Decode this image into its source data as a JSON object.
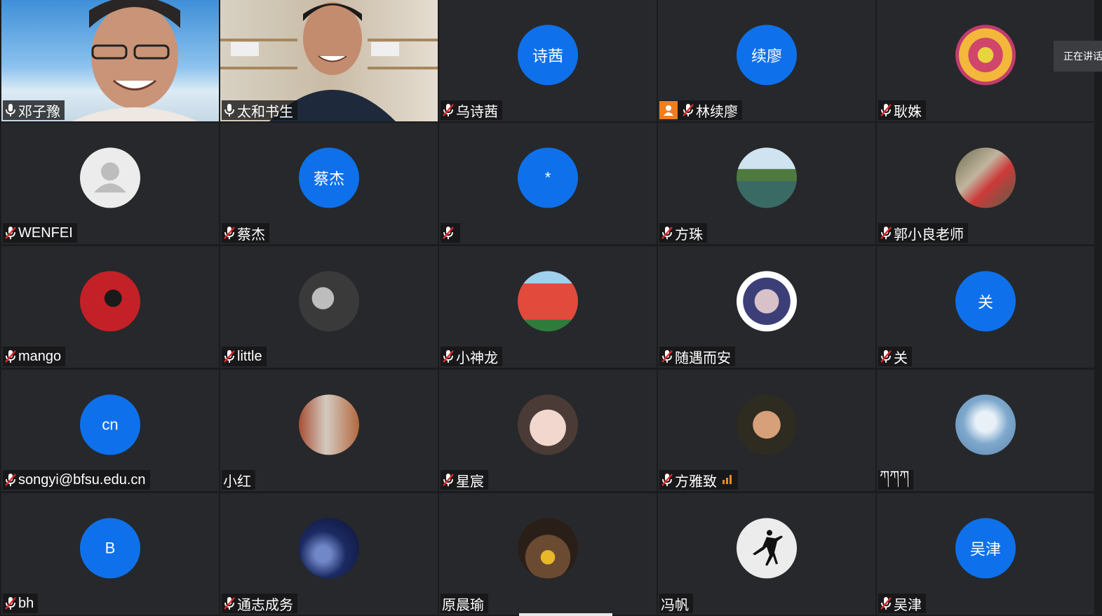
{
  "speaking_label": "正在讲话",
  "participants": [
    {
      "name": "邓子豫",
      "type": "video",
      "mic": "on",
      "avatar_text": "",
      "avatar_icon": "video-man-1"
    },
    {
      "name": "太和书生",
      "type": "video",
      "mic": "on",
      "avatar_text": "",
      "avatar_icon": "video-man-2"
    },
    {
      "name": "乌诗茜",
      "type": "initials",
      "mic": "muted",
      "avatar_text": "诗茜",
      "avatar_icon": ""
    },
    {
      "name": "林续廖",
      "type": "initials",
      "mic": "muted",
      "avatar_text": "续廖",
      "avatar_icon": "",
      "badge": "person-icon"
    },
    {
      "name": "耿姝",
      "type": "photo",
      "mic": "muted",
      "avatar_text": "",
      "avatar_icon": "mandala-photo"
    },
    {
      "name": "WENFEI",
      "type": "default",
      "mic": "muted",
      "avatar_text": "",
      "avatar_icon": "default-user-icon"
    },
    {
      "name": "蔡杰",
      "type": "initials",
      "mic": "muted",
      "avatar_text": "蔡杰",
      "avatar_icon": ""
    },
    {
      "name": "",
      "type": "initials",
      "mic": "muted",
      "avatar_text": "*",
      "avatar_icon": ""
    },
    {
      "name": "方珠",
      "type": "photo",
      "mic": "muted",
      "avatar_text": "",
      "avatar_icon": "lake-photo"
    },
    {
      "name": "郭小良老师",
      "type": "photo",
      "mic": "muted",
      "avatar_text": "",
      "avatar_icon": "child-photo"
    },
    {
      "name": "mango",
      "type": "photo",
      "mic": "muted",
      "avatar_text": "",
      "avatar_icon": "red-portrait-photo"
    },
    {
      "name": "little",
      "type": "photo",
      "mic": "muted",
      "avatar_text": "",
      "avatar_icon": "girl-bw-photo"
    },
    {
      "name": "小神龙",
      "type": "photo",
      "mic": "muted",
      "avatar_text": "",
      "avatar_icon": "watermelon-photo"
    },
    {
      "name": "随遇而安",
      "type": "photo",
      "mic": "muted",
      "avatar_text": "",
      "avatar_icon": "woman-portrait-photo"
    },
    {
      "name": "关",
      "type": "initials",
      "mic": "muted",
      "avatar_text": "关",
      "avatar_icon": ""
    },
    {
      "name": "songyi@bfsu.edu.cn",
      "type": "initials",
      "mic": "muted",
      "avatar_text": "cn",
      "avatar_icon": ""
    },
    {
      "name": "小红",
      "type": "photo",
      "mic": "none",
      "avatar_text": "",
      "avatar_icon": "walking-man-photo"
    },
    {
      "name": "星宸",
      "type": "photo",
      "mic": "muted",
      "avatar_text": "",
      "avatar_icon": "glasses-girl-photo"
    },
    {
      "name": "方雅致",
      "type": "photo",
      "mic": "muted",
      "avatar_text": "",
      "avatar_icon": "smiling-woman-photo",
      "signal": true
    },
    {
      "name": "ཀཀཀ",
      "type": "photo",
      "mic": "none",
      "avatar_text": "",
      "avatar_icon": "frost-tree-photo"
    },
    {
      "name": "bh",
      "type": "initials",
      "mic": "muted",
      "avatar_text": "B",
      "avatar_icon": ""
    },
    {
      "name": "通志成务",
      "type": "photo",
      "mic": "muted",
      "avatar_text": "",
      "avatar_icon": "night-sky-photo"
    },
    {
      "name": "原晨瑜",
      "type": "photo",
      "mic": "none",
      "avatar_text": "",
      "avatar_icon": "sunflower-girl-photo"
    },
    {
      "name": "冯帆",
      "type": "photo",
      "mic": "none",
      "avatar_text": "",
      "avatar_icon": "jumpman-logo"
    },
    {
      "name": "吴津",
      "type": "initials",
      "mic": "muted",
      "avatar_text": "吴津",
      "avatar_icon": ""
    }
  ]
}
